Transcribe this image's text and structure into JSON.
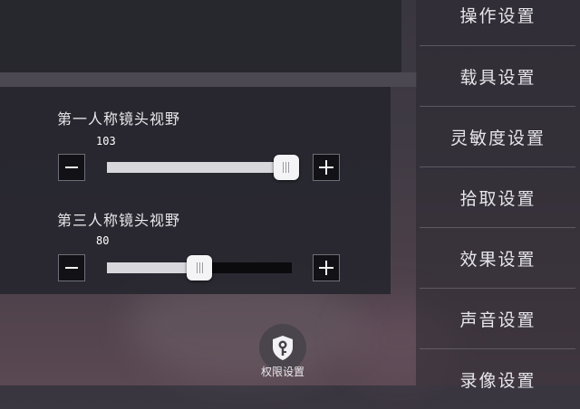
{
  "fov": {
    "first_person": {
      "label": "第一人称镜头视野",
      "value": "103",
      "level": 0.97
    },
    "third_person": {
      "label": "第三人称镜头视野",
      "value": "80",
      "level": 0.5
    }
  },
  "sidebar": {
    "items": [
      {
        "label": "操作设置"
      },
      {
        "label": "载具设置"
      },
      {
        "label": "灵敏度设置"
      },
      {
        "label": "拾取设置"
      },
      {
        "label": "效果设置"
      },
      {
        "label": "声音设置"
      },
      {
        "label": "录像设置"
      }
    ]
  },
  "permission": {
    "label": "权限设置",
    "icon": "key-shield-icon"
  }
}
